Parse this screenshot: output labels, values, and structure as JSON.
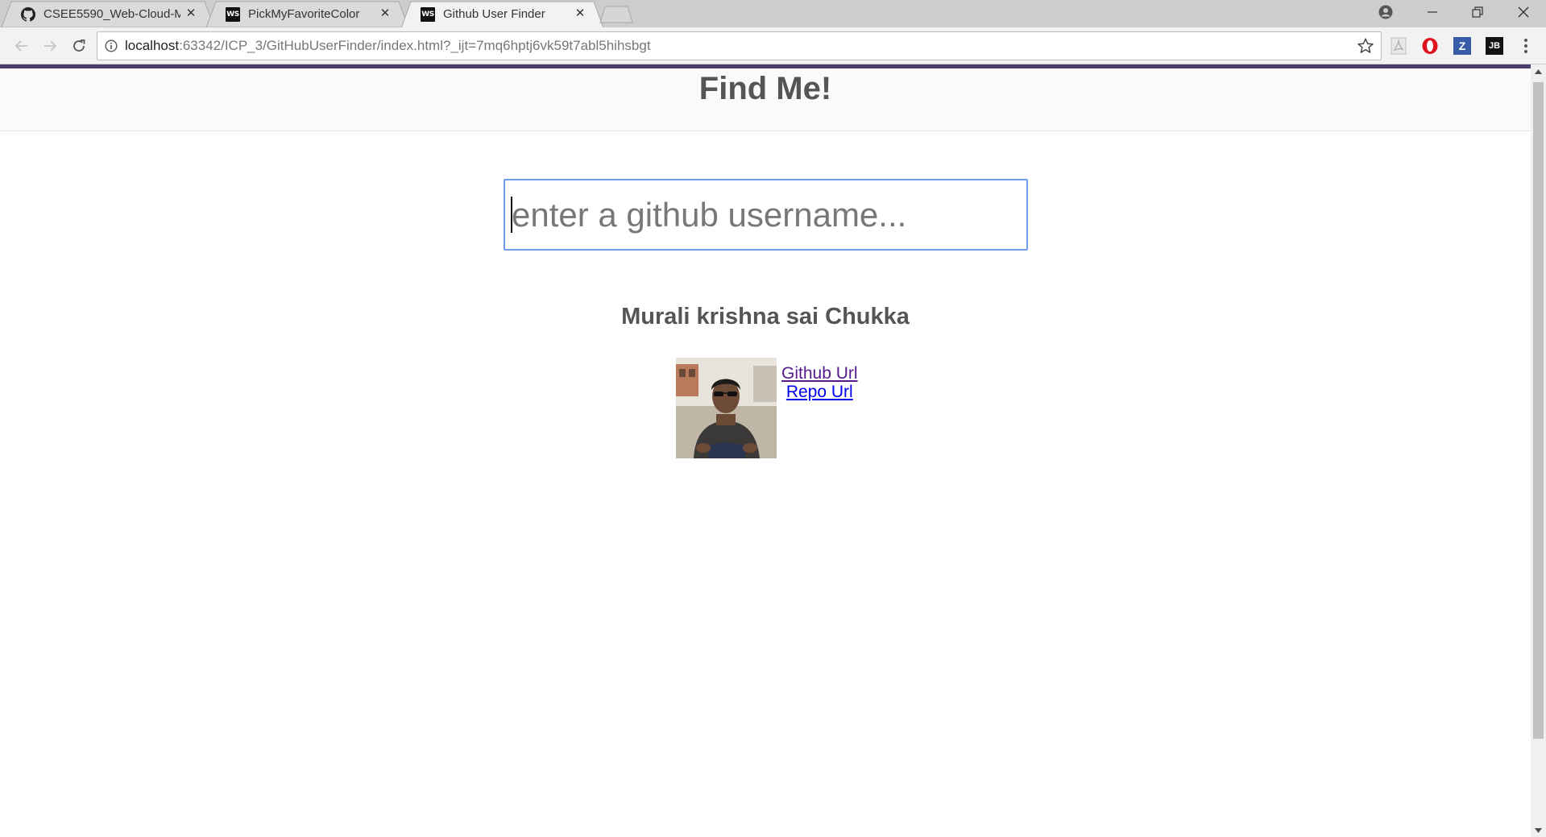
{
  "browser": {
    "tabs": [
      {
        "title": "CSEE5590_Web-Cloud-M",
        "favicon": "github-icon",
        "active": false
      },
      {
        "title": "PickMyFavoriteColor",
        "favicon": "webstorm-icon",
        "active": false
      },
      {
        "title": "Github User Finder",
        "favicon": "webstorm-icon",
        "active": true
      }
    ],
    "favicon_text": "WS",
    "address": {
      "host": "localhost",
      "rest": ":63342/ICP_3/GitHubUserFinder/index.html?_ijt=7mq6hptj6vk59t7abl5hihsbgt"
    },
    "extensions": {
      "z_label": "Z",
      "jb_label": "JB"
    }
  },
  "page": {
    "heading": "Find Me!",
    "search": {
      "placeholder": "enter a github username...",
      "value": ""
    },
    "user": {
      "name": "Murali krishna sai Chukka",
      "github_link": "Github Url",
      "repo_link": "Repo Url"
    }
  },
  "colors": {
    "accent": "#4c3e6e",
    "heading": "#555555",
    "visited_link": "#551a8b",
    "link": "#0000ee",
    "input_border": "#6e9ee8"
  }
}
